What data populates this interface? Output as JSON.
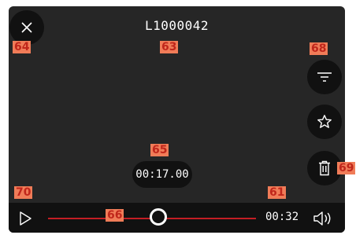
{
  "viewer": {
    "title": "L1000042",
    "current_time": "00:17.00",
    "duration": "00:32",
    "playback_progress": 0.53
  },
  "icons": {
    "close": "close-icon",
    "filter": "filter-icon",
    "favorite": "star-icon",
    "delete": "trash-icon",
    "play": "play-icon",
    "volume": "volume-icon"
  },
  "colors": {
    "accent": "#c41e24",
    "callout": "#f07c58"
  },
  "callouts": {
    "close": "64",
    "title": "63",
    "filter": "68",
    "current_time": "65",
    "delete": "69",
    "play": "70",
    "duration": "61",
    "scrubber": "66"
  }
}
